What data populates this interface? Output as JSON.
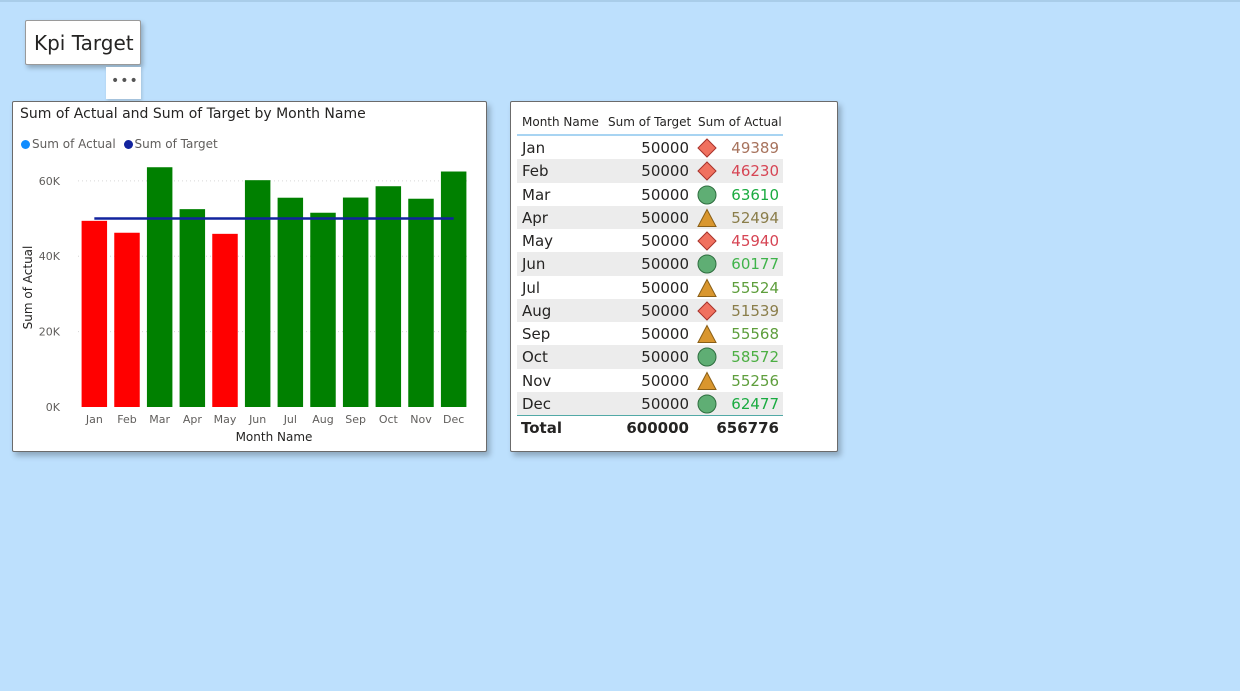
{
  "title_card": {
    "text": "Kpi Target",
    "more_label": "•••"
  },
  "chart_data": {
    "type": "bar",
    "title": "Sum of Actual and Sum of Target by Month Name",
    "xlabel": "Month Name",
    "ylabel": "Sum of Actual",
    "categories": [
      "Jan",
      "Feb",
      "Mar",
      "Apr",
      "May",
      "Jun",
      "Jul",
      "Aug",
      "Sep",
      "Oct",
      "Nov",
      "Dec"
    ],
    "ylim": [
      0,
      65000
    ],
    "yticks": [
      0,
      20000,
      40000,
      60000
    ],
    "ytick_labels": [
      "0K",
      "20K",
      "40K",
      "60K"
    ],
    "grid": true,
    "legend": "top-left",
    "series": [
      {
        "name": "Sum of Actual",
        "kind": "bar",
        "legend_color": "#118dff",
        "values": [
          49389,
          46230,
          63610,
          52494,
          45940,
          60177,
          55524,
          51539,
          55568,
          58572,
          55256,
          62477
        ],
        "bar_colors": [
          "#ff0000",
          "#ff0000",
          "#008000",
          "#008000",
          "#ff0000",
          "#008000",
          "#008000",
          "#008000",
          "#008000",
          "#008000",
          "#008000",
          "#008000"
        ]
      },
      {
        "name": "Sum of Target",
        "kind": "line",
        "color": "#12239e",
        "values": [
          50000,
          50000,
          50000,
          50000,
          50000,
          50000,
          50000,
          50000,
          50000,
          50000,
          50000,
          50000
        ]
      }
    ]
  },
  "table": {
    "headers": [
      "Month Name",
      "Sum of Target",
      "Sum of Actual"
    ],
    "rows": [
      {
        "month": "Jan",
        "target": "50000",
        "actual": "49389",
        "icon": "diamond-icon",
        "color": "#a7735d"
      },
      {
        "month": "Feb",
        "target": "50000",
        "actual": "46230",
        "icon": "diamond-icon",
        "color": "#d64554"
      },
      {
        "month": "Mar",
        "target": "50000",
        "actual": "63610",
        "icon": "circle-icon",
        "color": "#1aab40"
      },
      {
        "month": "Apr",
        "target": "50000",
        "actual": "52494",
        "icon": "triangle-icon",
        "color": "#8a7d4a"
      },
      {
        "month": "May",
        "target": "50000",
        "actual": "45940",
        "icon": "diamond-icon",
        "color": "#d64554"
      },
      {
        "month": "Jun",
        "target": "50000",
        "actual": "60177",
        "icon": "circle-icon",
        "color": "#3fb34a"
      },
      {
        "month": "Jul",
        "target": "50000",
        "actual": "55524",
        "icon": "triangle-icon",
        "color": "#5e9e3c"
      },
      {
        "month": "Aug",
        "target": "50000",
        "actual": "51539",
        "icon": "diamond-icon",
        "color": "#8a7d4a"
      },
      {
        "month": "Sep",
        "target": "50000",
        "actual": "55568",
        "icon": "triangle-icon",
        "color": "#5e9e3c"
      },
      {
        "month": "Oct",
        "target": "50000",
        "actual": "58572",
        "icon": "circle-icon",
        "color": "#4caf43"
      },
      {
        "month": "Nov",
        "target": "50000",
        "actual": "55256",
        "icon": "triangle-icon",
        "color": "#5e9e3c"
      },
      {
        "month": "Dec",
        "target": "50000",
        "actual": "62477",
        "icon": "circle-icon",
        "color": "#1aab40"
      }
    ],
    "total": {
      "label": "Total",
      "target": "600000",
      "actual": "656776"
    },
    "icon_colors": {
      "diamond": "#f0715f",
      "circle": "#5fae74",
      "triangle": "#d9962e"
    }
  }
}
